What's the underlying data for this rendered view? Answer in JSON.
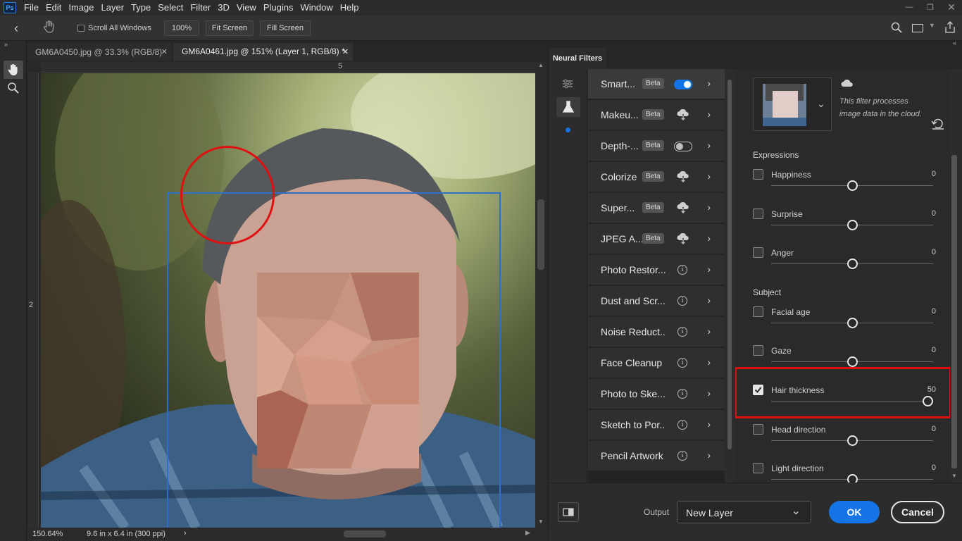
{
  "app": {
    "logo": "Ps"
  },
  "menubar": {
    "items": [
      "File",
      "Edit",
      "Image",
      "Layer",
      "Type",
      "Select",
      "Filter",
      "3D",
      "View",
      "Plugins",
      "Window",
      "Help"
    ]
  },
  "options_bar": {
    "scroll_all_windows": "Scroll All Windows",
    "zoom_100": "100%",
    "fit_screen": "Fit Screen",
    "fill_screen": "Fill Screen"
  },
  "tabs": [
    {
      "label": "GM6A0450.jpg @ 33.3% (RGB/8)",
      "active": false
    },
    {
      "label": "GM6A0461.jpg @ 151% (Layer 1, RGB/8) *",
      "active": true
    }
  ],
  "rulers": {
    "top_mark": "5",
    "left_mark": "2"
  },
  "status": {
    "zoom": "150.64%",
    "doc_size": "9.6 in x 6.4 in (300 ppi)"
  },
  "neural_filters": {
    "panel_tab": "Neural Filters",
    "filters": [
      {
        "label": "Smart...",
        "badge": "Beta",
        "control": "toggle-on"
      },
      {
        "label": "Makeu...",
        "badge": "Beta",
        "control": "cloud"
      },
      {
        "label": "Depth-...",
        "badge": "Beta",
        "control": "toggle-off"
      },
      {
        "label": "Colorize",
        "badge": "Beta",
        "control": "cloud"
      },
      {
        "label": "Super...",
        "badge": "Beta",
        "control": "cloud"
      },
      {
        "label": "JPEG A...",
        "badge": "Beta",
        "control": "cloud"
      },
      {
        "label": "Photo Restor...",
        "badge": "",
        "control": "info"
      },
      {
        "label": "Dust and Scr...",
        "badge": "",
        "control": "info"
      },
      {
        "label": "Noise Reduct...",
        "badge": "",
        "control": "info"
      },
      {
        "label": "Face Cleanup",
        "badge": "",
        "control": "info"
      },
      {
        "label": "Photo to Ske...",
        "badge": "",
        "control": "info"
      },
      {
        "label": "Sketch to Por...",
        "badge": "",
        "control": "info"
      },
      {
        "label": "Pencil Artwork",
        "badge": "",
        "control": "info"
      }
    ],
    "cloud_note": "This filter processes image data in the cloud.",
    "groups": {
      "expressions": "Expressions",
      "subject": "Subject"
    },
    "params": [
      {
        "label": "Happiness",
        "value": "0",
        "checked": false,
        "level": 0.5
      },
      {
        "label": "Surprise",
        "value": "0",
        "checked": false,
        "level": 0.5
      },
      {
        "label": "Anger",
        "value": "0",
        "checked": false,
        "level": 0.5
      },
      {
        "label": "Facial age",
        "value": "0",
        "checked": false,
        "level": 0.5
      },
      {
        "label": "Gaze",
        "value": "0",
        "checked": false,
        "level": 0.5
      },
      {
        "label": "Hair thickness",
        "value": "50",
        "checked": true,
        "level": 1.0
      },
      {
        "label": "Head direction",
        "value": "0",
        "checked": false,
        "level": 0.5
      },
      {
        "label": "Light direction",
        "value": "0",
        "checked": false,
        "level": 0.5
      }
    ],
    "output_label": "Output",
    "output_value": "New Layer",
    "ok": "OK",
    "cancel": "Cancel"
  },
  "colors": {
    "accent": "#1473e6",
    "highlight_red": "#e01010",
    "face_box": "#2f6fc4"
  }
}
